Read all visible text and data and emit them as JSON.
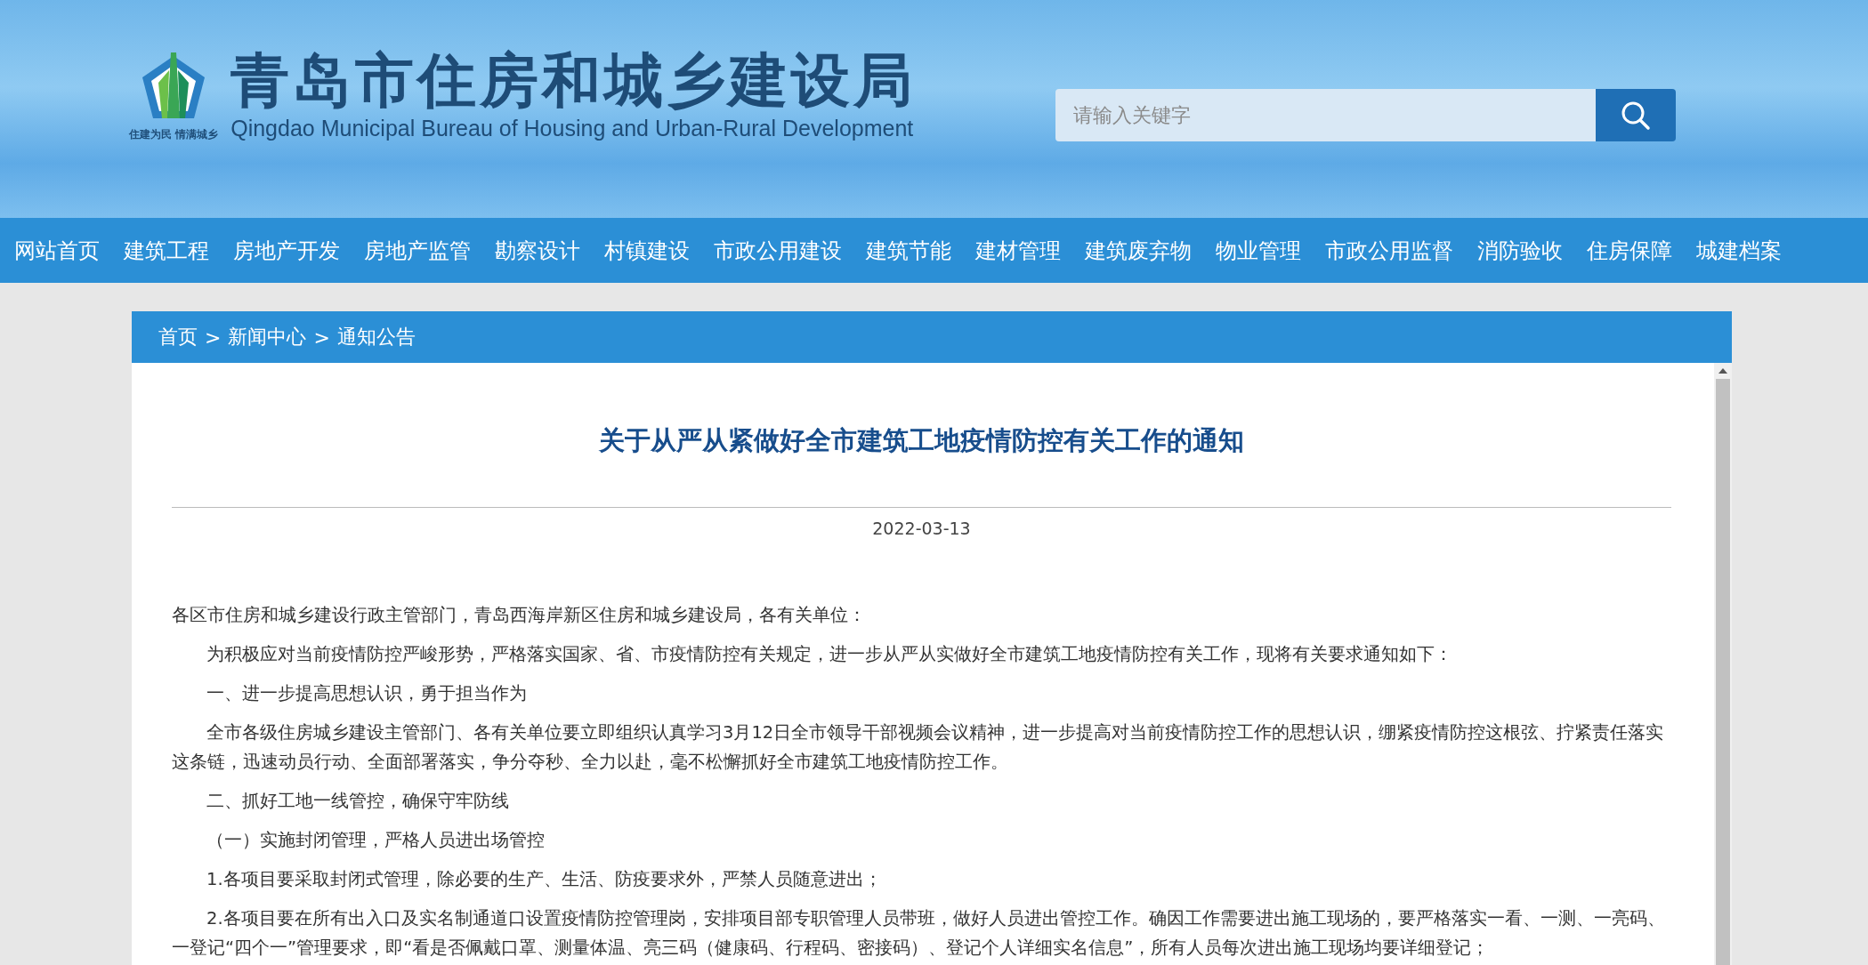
{
  "header": {
    "slogan": "住建为民 情满城乡",
    "title": "青岛市住房和城乡建设局",
    "subtitle": "Qingdao Municipal Bureau of Housing and Urban-Rural Development",
    "search": {
      "placeholder": "请输入关键字"
    }
  },
  "nav": {
    "items": [
      {
        "label": "网站首页"
      },
      {
        "label": "建筑工程"
      },
      {
        "label": "房地产开发"
      },
      {
        "label": "房地产监管"
      },
      {
        "label": "勘察设计"
      },
      {
        "label": "村镇建设"
      },
      {
        "label": "市政公用建设"
      },
      {
        "label": "建筑节能"
      },
      {
        "label": "建材管理"
      },
      {
        "label": "建筑废弃物"
      },
      {
        "label": "物业管理"
      },
      {
        "label": "市政公用监督"
      },
      {
        "label": "消防验收"
      },
      {
        "label": "住房保障"
      },
      {
        "label": "城建档案"
      }
    ]
  },
  "breadcrumb": {
    "separator": ">",
    "items": [
      "首页",
      "新闻中心",
      "通知公告"
    ]
  },
  "article": {
    "title": "关于从严从紧做好全市建筑工地疫情防控有关工作的通知",
    "date": "2022-03-13",
    "paragraphs": [
      {
        "indent": false,
        "text": "各区市住房和城乡建设行政主管部门，青岛西海岸新区住房和城乡建设局，各有关单位："
      },
      {
        "indent": true,
        "text": "为积极应对当前疫情防控严峻形势，严格落实国家、省、市疫情防控有关规定，进一步从严从实做好全市建筑工地疫情防控有关工作，现将有关要求通知如下："
      },
      {
        "indent": true,
        "text": "一、进一步提高思想认识，勇于担当作为"
      },
      {
        "indent": true,
        "text": "全市各级住房城乡建设主管部门、各有关单位要立即组织认真学习3月12日全市领导干部视频会议精神，进一步提高对当前疫情防控工作的思想认识，绷紧疫情防控这根弦、拧紧责任落实这条链，迅速动员行动、全面部署落实，争分夺秒、全力以赴，毫不松懈抓好全市建筑工地疫情防控工作。"
      },
      {
        "indent": true,
        "text": "二、抓好工地一线管控，确保守牢防线"
      },
      {
        "indent": true,
        "text": "（一）实施封闭管理，严格人员进出场管控"
      },
      {
        "indent": true,
        "text": "1.各项目要采取封闭式管理，除必要的生产、生活、防疫要求外，严禁人员随意进出；"
      },
      {
        "indent": true,
        "text": "2.各项目要在所有出入口及实名制通道口设置疫情防控管理岗，安排项目部专职管理人员带班，做好人员进出管控工作。确因工作需要进出施工现场的，要严格落实一看、一测、一亮码、一登记“四个一”管理要求，即“看是否佩戴口罩、测量体温、亮三码（健康码、行程码、密接码）、登记个人详细实名信息”，所有人员每次进出施工现场均要详细登记；"
      }
    ]
  }
}
